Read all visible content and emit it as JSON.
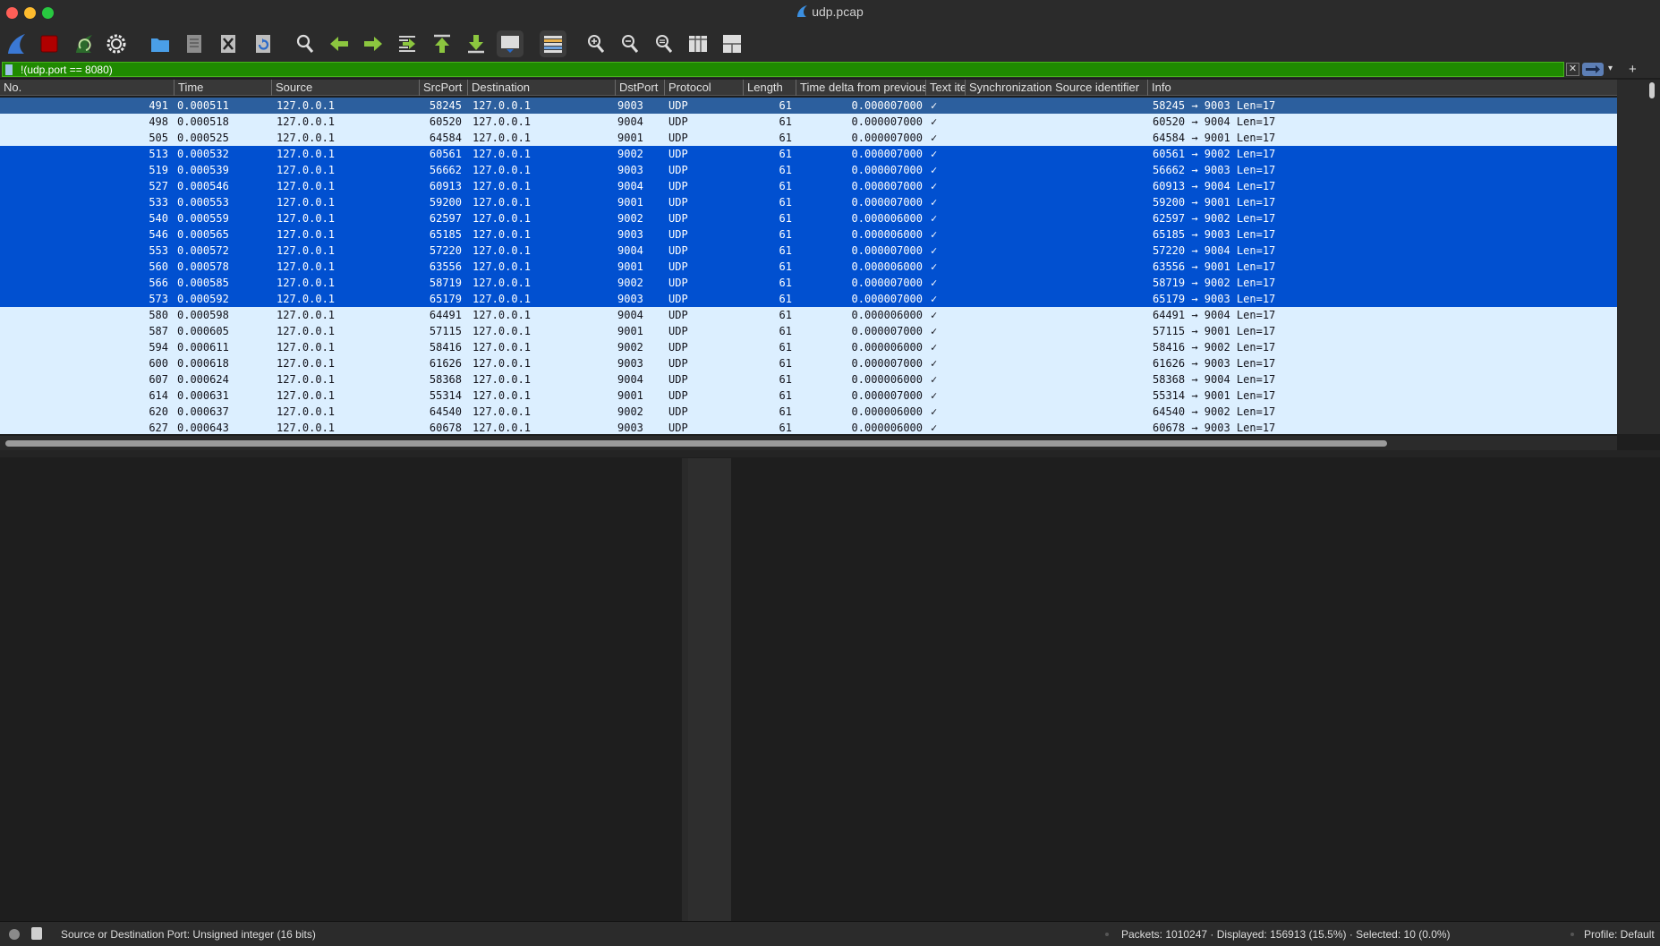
{
  "window": {
    "title": "udp.pcap"
  },
  "toolbar": {
    "buttons": [
      {
        "name": "start-capture-button",
        "icon": "shark-fin-icon"
      },
      {
        "name": "stop-capture-button",
        "icon": "stop-icon"
      },
      {
        "name": "restart-capture-button",
        "icon": "restart-fin-icon"
      },
      {
        "name": "capture-options-button",
        "icon": "gear-icon"
      },
      {
        "name": "open-file-button",
        "icon": "folder-icon"
      },
      {
        "name": "save-file-button",
        "icon": "document-icon"
      },
      {
        "name": "close-file-button",
        "icon": "close-file-icon"
      },
      {
        "name": "reload-file-button",
        "icon": "reload-icon"
      },
      {
        "name": "find-packet-button",
        "icon": "magnifier-icon"
      },
      {
        "name": "go-back-button",
        "icon": "arrow-left-icon"
      },
      {
        "name": "go-forward-button",
        "icon": "arrow-right-icon"
      },
      {
        "name": "go-to-packet-button",
        "icon": "goto-icon"
      },
      {
        "name": "go-first-button",
        "icon": "arrow-up-bar-icon"
      },
      {
        "name": "go-last-button",
        "icon": "arrow-down-bar-icon"
      },
      {
        "name": "autoscroll-button",
        "icon": "autoscroll-icon"
      },
      {
        "name": "colorize-button",
        "icon": "colorize-icon"
      },
      {
        "name": "zoom-in-button",
        "icon": "zoom-in-icon"
      },
      {
        "name": "zoom-out-button",
        "icon": "zoom-out-icon"
      },
      {
        "name": "normal-size-button",
        "icon": "zoom-reset-icon"
      },
      {
        "name": "resize-columns-button",
        "icon": "resize-columns-icon"
      },
      {
        "name": "layout-button",
        "icon": "layout-123-icon"
      }
    ]
  },
  "filter": {
    "text": "!(udp.port == 8080)",
    "bg_color": "#1f8a00",
    "clear_glyph": "✕",
    "dropdown_glyph": "▾",
    "add_glyph": "+"
  },
  "columns": [
    "No.",
    "Time",
    "Source",
    "SrcPort",
    "Destination",
    "DstPort",
    "Protocol",
    "Length",
    "Time delta from previous displayed frame",
    "Text item",
    "Synchronization Source identifier",
    "Info"
  ],
  "rows": [
    {
      "no": "491",
      "time": "0.000511",
      "src": "127.0.0.1",
      "sport": "58245",
      "dst": "127.0.0.1",
      "dport": "9003",
      "proto": "UDP",
      "len": "61",
      "delta": "0.000007000",
      "text": "✓",
      "ssrc": "",
      "info": "58245 → 9003 Len=17",
      "state": "cur"
    },
    {
      "no": "498",
      "time": "0.000518",
      "src": "127.0.0.1",
      "sport": "60520",
      "dst": "127.0.0.1",
      "dport": "9004",
      "proto": "UDP",
      "len": "61",
      "delta": "0.000007000",
      "text": "✓",
      "ssrc": "",
      "info": "60520 → 9004 Len=17",
      "state": "normal"
    },
    {
      "no": "505",
      "time": "0.000525",
      "src": "127.0.0.1",
      "sport": "64584",
      "dst": "127.0.0.1",
      "dport": "9001",
      "proto": "UDP",
      "len": "61",
      "delta": "0.000007000",
      "text": "✓",
      "ssrc": "",
      "info": "64584 → 9001 Len=17",
      "state": "normal"
    },
    {
      "no": "513",
      "time": "0.000532",
      "src": "127.0.0.1",
      "sport": "60561",
      "dst": "127.0.0.1",
      "dport": "9002",
      "proto": "UDP",
      "len": "61",
      "delta": "0.000007000",
      "text": "✓",
      "ssrc": "",
      "info": "60561 → 9002 Len=17",
      "state": "sel"
    },
    {
      "no": "519",
      "time": "0.000539",
      "src": "127.0.0.1",
      "sport": "56662",
      "dst": "127.0.0.1",
      "dport": "9003",
      "proto": "UDP",
      "len": "61",
      "delta": "0.000007000",
      "text": "✓",
      "ssrc": "",
      "info": "56662 → 9003 Len=17",
      "state": "sel"
    },
    {
      "no": "527",
      "time": "0.000546",
      "src": "127.0.0.1",
      "sport": "60913",
      "dst": "127.0.0.1",
      "dport": "9004",
      "proto": "UDP",
      "len": "61",
      "delta": "0.000007000",
      "text": "✓",
      "ssrc": "",
      "info": "60913 → 9004 Len=17",
      "state": "sel"
    },
    {
      "no": "533",
      "time": "0.000553",
      "src": "127.0.0.1",
      "sport": "59200",
      "dst": "127.0.0.1",
      "dport": "9001",
      "proto": "UDP",
      "len": "61",
      "delta": "0.000007000",
      "text": "✓",
      "ssrc": "",
      "info": "59200 → 9001 Len=17",
      "state": "sel"
    },
    {
      "no": "540",
      "time": "0.000559",
      "src": "127.0.0.1",
      "sport": "62597",
      "dst": "127.0.0.1",
      "dport": "9002",
      "proto": "UDP",
      "len": "61",
      "delta": "0.000006000",
      "text": "✓",
      "ssrc": "",
      "info": "62597 → 9002 Len=17",
      "state": "sel"
    },
    {
      "no": "546",
      "time": "0.000565",
      "src": "127.0.0.1",
      "sport": "65185",
      "dst": "127.0.0.1",
      "dport": "9003",
      "proto": "UDP",
      "len": "61",
      "delta": "0.000006000",
      "text": "✓",
      "ssrc": "",
      "info": "65185 → 9003 Len=17",
      "state": "sel"
    },
    {
      "no": "553",
      "time": "0.000572",
      "src": "127.0.0.1",
      "sport": "57220",
      "dst": "127.0.0.1",
      "dport": "9004",
      "proto": "UDP",
      "len": "61",
      "delta": "0.000007000",
      "text": "✓",
      "ssrc": "",
      "info": "57220 → 9004 Len=17",
      "state": "sel"
    },
    {
      "no": "560",
      "time": "0.000578",
      "src": "127.0.0.1",
      "sport": "63556",
      "dst": "127.0.0.1",
      "dport": "9001",
      "proto": "UDP",
      "len": "61",
      "delta": "0.000006000",
      "text": "✓",
      "ssrc": "",
      "info": "63556 → 9001 Len=17",
      "state": "sel"
    },
    {
      "no": "566",
      "time": "0.000585",
      "src": "127.0.0.1",
      "sport": "58719",
      "dst": "127.0.0.1",
      "dport": "9002",
      "proto": "UDP",
      "len": "61",
      "delta": "0.000007000",
      "text": "✓",
      "ssrc": "",
      "info": "58719 → 9002 Len=17",
      "state": "sel"
    },
    {
      "no": "573",
      "time": "0.000592",
      "src": "127.0.0.1",
      "sport": "65179",
      "dst": "127.0.0.1",
      "dport": "9003",
      "proto": "UDP",
      "len": "61",
      "delta": "0.000007000",
      "text": "✓",
      "ssrc": "",
      "info": "65179 → 9003 Len=17",
      "state": "sel"
    },
    {
      "no": "580",
      "time": "0.000598",
      "src": "127.0.0.1",
      "sport": "64491",
      "dst": "127.0.0.1",
      "dport": "9004",
      "proto": "UDP",
      "len": "61",
      "delta": "0.000006000",
      "text": "✓",
      "ssrc": "",
      "info": "64491 → 9004 Len=17",
      "state": "normal"
    },
    {
      "no": "587",
      "time": "0.000605",
      "src": "127.0.0.1",
      "sport": "57115",
      "dst": "127.0.0.1",
      "dport": "9001",
      "proto": "UDP",
      "len": "61",
      "delta": "0.000007000",
      "text": "✓",
      "ssrc": "",
      "info": "57115 → 9001 Len=17",
      "state": "normal"
    },
    {
      "no": "594",
      "time": "0.000611",
      "src": "127.0.0.1",
      "sport": "58416",
      "dst": "127.0.0.1",
      "dport": "9002",
      "proto": "UDP",
      "len": "61",
      "delta": "0.000006000",
      "text": "✓",
      "ssrc": "",
      "info": "58416 → 9002 Len=17",
      "state": "normal"
    },
    {
      "no": "600",
      "time": "0.000618",
      "src": "127.0.0.1",
      "sport": "61626",
      "dst": "127.0.0.1",
      "dport": "9003",
      "proto": "UDP",
      "len": "61",
      "delta": "0.000007000",
      "text": "✓",
      "ssrc": "",
      "info": "61626 → 9003 Len=17",
      "state": "normal"
    },
    {
      "no": "607",
      "time": "0.000624",
      "src": "127.0.0.1",
      "sport": "58368",
      "dst": "127.0.0.1",
      "dport": "9004",
      "proto": "UDP",
      "len": "61",
      "delta": "0.000006000",
      "text": "✓",
      "ssrc": "",
      "info": "58368 → 9004 Len=17",
      "state": "normal"
    },
    {
      "no": "614",
      "time": "0.000631",
      "src": "127.0.0.1",
      "sport": "55314",
      "dst": "127.0.0.1",
      "dport": "9001",
      "proto": "UDP",
      "len": "61",
      "delta": "0.000007000",
      "text": "✓",
      "ssrc": "",
      "info": "55314 → 9001 Len=17",
      "state": "normal"
    },
    {
      "no": "620",
      "time": "0.000637",
      "src": "127.0.0.1",
      "sport": "64540",
      "dst": "127.0.0.1",
      "dport": "9002",
      "proto": "UDP",
      "len": "61",
      "delta": "0.000006000",
      "text": "✓",
      "ssrc": "",
      "info": "64540 → 9002 Len=17",
      "state": "normal"
    },
    {
      "no": "627",
      "time": "0.000643",
      "src": "127.0.0.1",
      "sport": "60678",
      "dst": "127.0.0.1",
      "dport": "9003",
      "proto": "UDP",
      "len": "61",
      "delta": "0.000006000",
      "text": "✓",
      "ssrc": "",
      "info": "60678 → 9003 Len=17",
      "state": "normal"
    }
  ],
  "colors": {
    "row_normal": "#dcefff",
    "row_selected": "#0150d0",
    "row_current": "#2c5f9e",
    "filter_valid": "#1f8a00"
  },
  "status": {
    "hint": "Source or Destination Port: Unsigned integer (16 bits)",
    "counts": "Packets: 1010247 · Displayed: 156913 (15.5%) · Selected: 10 (0.0%)",
    "profile": "Profile: Default"
  }
}
